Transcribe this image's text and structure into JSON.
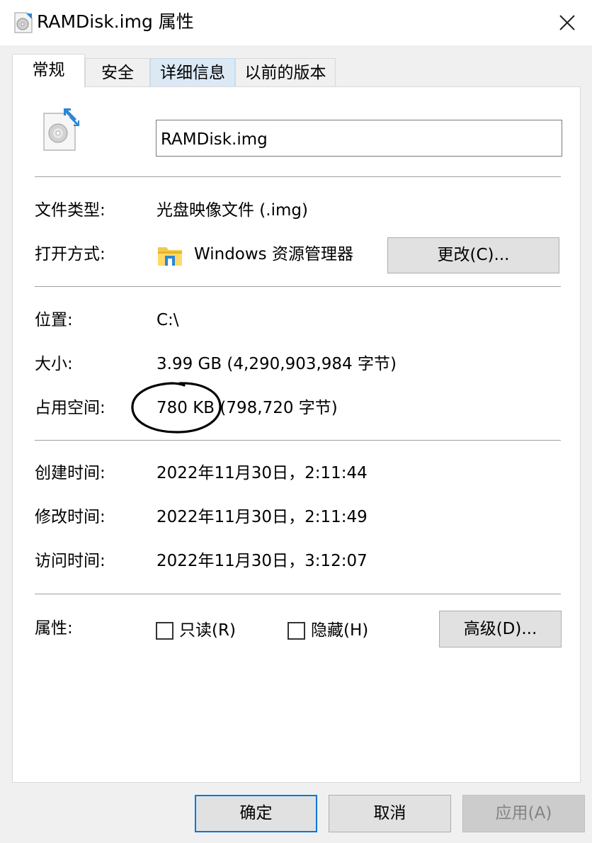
{
  "window": {
    "title": "RAMDisk.img 属性",
    "close_icon": "close-icon"
  },
  "tabs": [
    {
      "label": "常规",
      "active": true
    },
    {
      "label": "安全",
      "active": false
    },
    {
      "label": "详细信息",
      "active": false
    },
    {
      "label": "以前的版本",
      "active": false
    }
  ],
  "general": {
    "file_name": "RAMDisk.img",
    "file_type_label": "文件类型:",
    "file_type_value": "光盘映像文件 (.img)",
    "opens_with_label": "打开方式:",
    "opens_with_value": "Windows 资源管理器",
    "change_button": "更改(C)...",
    "location_label": "位置:",
    "location_value": "C:\\",
    "size_label": "大小:",
    "size_value": "3.99 GB (4,290,903,984 字节)",
    "size_on_disk_label": "占用空间:",
    "size_on_disk_value": "780 KB (798,720 字节)",
    "created_label": "创建时间:",
    "created_value": "2022年11月30日，2:11:44",
    "modified_label": "修改时间:",
    "modified_value": "2022年11月30日，2:11:49",
    "accessed_label": "访问时间:",
    "accessed_value": "2022年11月30日，3:12:07",
    "attributes_label": "属性:",
    "readonly_label": "只读(R)",
    "readonly_checked": false,
    "hidden_label": "隐藏(H)",
    "hidden_checked": false,
    "advanced_button": "高级(D)..."
  },
  "footer": {
    "ok_button": "确定",
    "cancel_button": "取消",
    "apply_button": "应用(A)"
  },
  "colors": {
    "focus_border": "#0078d7",
    "tab_hover": "#dbe9f5"
  }
}
